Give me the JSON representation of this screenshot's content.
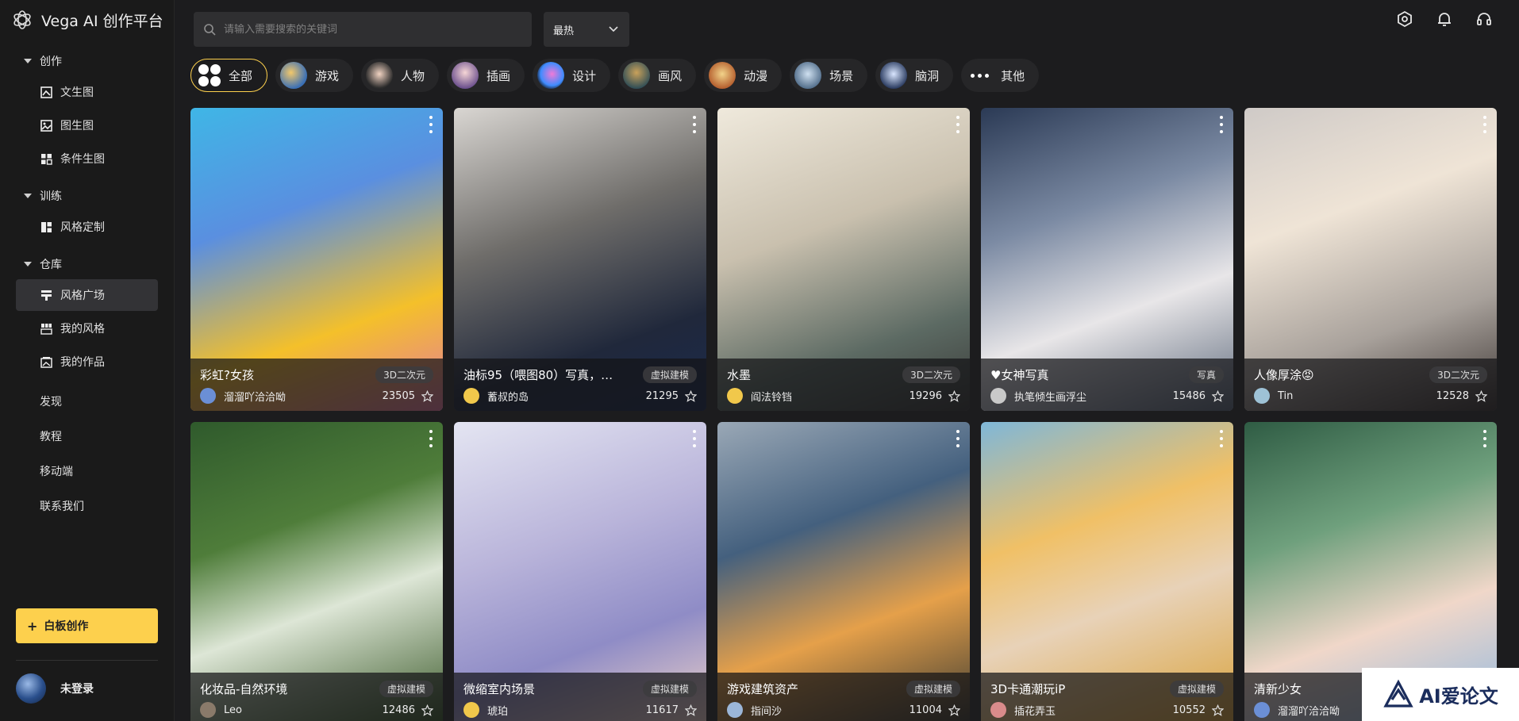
{
  "brand": {
    "name": "Vega AI 创作平台"
  },
  "sidebar": {
    "sections": [
      {
        "label": "创作",
        "items": [
          {
            "label": "文生图",
            "icon": "image-text-icon"
          },
          {
            "label": "图生图",
            "icon": "image-icon"
          },
          {
            "label": "条件生图",
            "icon": "grid-condition-icon"
          }
        ]
      },
      {
        "label": "训练",
        "items": [
          {
            "label": "风格定制",
            "icon": "style-custom-icon"
          }
        ]
      },
      {
        "label": "仓库",
        "items": [
          {
            "label": "风格广场",
            "icon": "style-square-icon",
            "active": true
          },
          {
            "label": "我的风格",
            "icon": "my-style-icon"
          },
          {
            "label": "我的作品",
            "icon": "my-works-icon"
          }
        ]
      }
    ],
    "links": [
      "发现",
      "教程",
      "移动端",
      "联系我们"
    ],
    "board_button": "白板创作",
    "user_label": "未登录"
  },
  "search": {
    "placeholder": "请输入需要搜索的关键词"
  },
  "sort": {
    "selected": "最热"
  },
  "categories": [
    {
      "label": "全部",
      "active": true
    },
    {
      "label": "游戏"
    },
    {
      "label": "人物"
    },
    {
      "label": "插画"
    },
    {
      "label": "设计"
    },
    {
      "label": "画风"
    },
    {
      "label": "动漫"
    },
    {
      "label": "场景"
    },
    {
      "label": "脑洞"
    },
    {
      "label": "其他"
    }
  ],
  "cards": [
    {
      "title": "彩虹?女孩",
      "tag": "3D二次元",
      "author": "溜溜吖洽洽呦",
      "count": "23505"
    },
    {
      "title": "油标95（喂图80）写真，…",
      "tag": "虚拟建模",
      "author": "蓄叔的岛",
      "count": "21295"
    },
    {
      "title": "水墨",
      "tag": "3D二次元",
      "author": "阎法铃铛",
      "count": "19296"
    },
    {
      "title": "♥女神写真",
      "tag": "写真",
      "author": "执笔倾生画浮尘",
      "count": "15486"
    },
    {
      "title": "人像厚涂😡",
      "tag": "3D二次元",
      "author": "Tin",
      "count": "12528"
    },
    {
      "title": "化妆品-自然环境",
      "tag": "虚拟建模",
      "author": "Leo",
      "count": "12486"
    },
    {
      "title": "微缩室内场景",
      "tag": "虚拟建模",
      "author": "琥珀",
      "count": "11617"
    },
    {
      "title": "游戏建筑资产",
      "tag": "虚拟建模",
      "author": "指间沙",
      "count": "11004"
    },
    {
      "title": "3D卡通潮玩iP",
      "tag": "虚拟建模",
      "author": "插花弄玉",
      "count": "10552"
    },
    {
      "title": "清新少女",
      "tag": "",
      "author": "溜溜吖洽洽呦",
      "count": ""
    }
  ],
  "watermark": {
    "text": "AI爱论文"
  },
  "colors": {
    "accent": "#fdd04d",
    "background": "#1c1c1e",
    "sidebar": "#1a1a1a",
    "active_item": "#333336"
  }
}
